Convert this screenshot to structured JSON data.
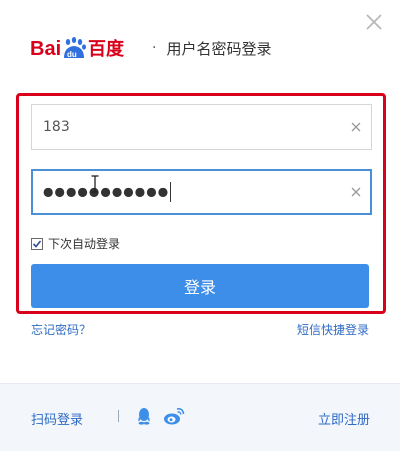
{
  "header": {
    "logo_text": "Bai du 百度",
    "separator": "·",
    "title": "用户名密码登录"
  },
  "form": {
    "username_value": "183",
    "password_value": "●●●●●●●●●●●",
    "remember_label": "下次自动登录",
    "remember_checked": true,
    "login_label": "登录",
    "forgot_label": "忘记密码？",
    "sms_label": "短信快捷登录"
  },
  "footer": {
    "qr_label": "扫码登录",
    "register_label": "立即注册"
  },
  "colors": {
    "primary": "#3d8ee8",
    "link": "#2e6bc4",
    "highlight": "#d9001b",
    "footer_bg": "#f3f6fb"
  },
  "icons": [
    "close-icon",
    "clear-icon",
    "checkbox-check-icon",
    "text-cursor-icon",
    "qq-icon",
    "weibo-icon",
    "baidu-paw-icon"
  ]
}
